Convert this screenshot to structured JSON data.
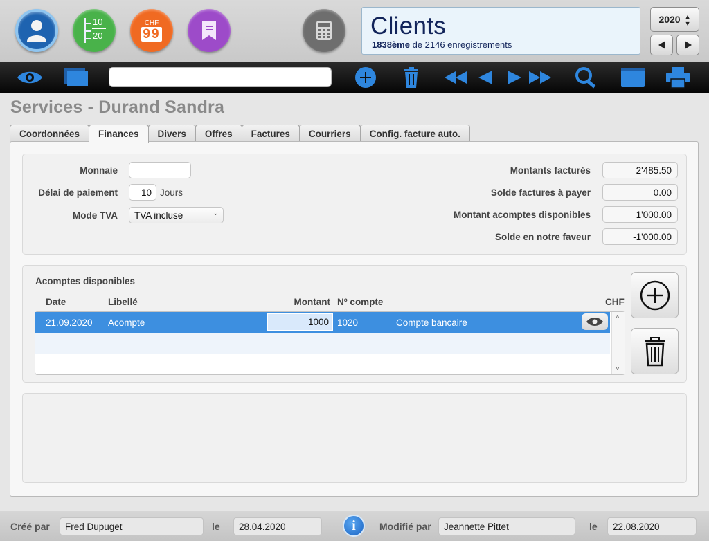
{
  "header": {
    "title": "Clients",
    "record_position": "1838ème",
    "record_total_text": "de 2146 enregistrements",
    "year": "2020",
    "green_icon_top": "10",
    "green_icon_bottom": "20",
    "orange_icon_currency": "CHF",
    "orange_icon_digits": "99"
  },
  "page": {
    "title": "Services - Durand Sandra"
  },
  "tabs": [
    {
      "label": "Coordonnées",
      "active": false
    },
    {
      "label": "Finances",
      "active": true
    },
    {
      "label": "Divers",
      "active": false
    },
    {
      "label": "Offres",
      "active": false
    },
    {
      "label": "Factures",
      "active": false
    },
    {
      "label": "Courriers",
      "active": false
    },
    {
      "label": "Config. facture auto.",
      "active": false
    }
  ],
  "finances": {
    "monnaie_label": "Monnaie",
    "monnaie_value": "",
    "delai_label": "Délai de paiement",
    "delai_value": "10",
    "delai_unit": "Jours",
    "mode_tva_label": "Mode TVA",
    "mode_tva_value": "TVA incluse",
    "montants_factures_label": "Montants facturés",
    "montants_factures_value": "2'485.50",
    "solde_factures_label": "Solde factures à payer",
    "solde_factures_value": "0.00",
    "acomptes_dispo_label": "Montant acomptes disponibles",
    "acomptes_dispo_value": "1'000.00",
    "solde_faveur_label": "Solde en notre faveur",
    "solde_faveur_value": "-1'000.00"
  },
  "acomptes": {
    "section_title": "Acomptes disponibles",
    "columns": {
      "date": "Date",
      "libelle": "Libellé",
      "montant": "Montant",
      "compte": "Nº compte",
      "currency": "CHF"
    },
    "rows": [
      {
        "date": "21.09.2020",
        "libelle": "Acompte",
        "montant": "1000",
        "compte": "1020",
        "compte_label": "Compte bancaire"
      }
    ]
  },
  "footer": {
    "cree_par_label": "Créé par",
    "cree_par_value": "Fred Dupuget",
    "le1_label": "le",
    "le1_value": "28.04.2020",
    "modifie_par_label": "Modifié par",
    "modifie_par_value": "Jeannette Pittet",
    "le2_label": "le",
    "le2_value": "22.08.2020"
  },
  "colors": {
    "accent_blue": "#3d8fe0",
    "title_navy": "#12245a",
    "toolbar_icon": "#2e86de"
  }
}
